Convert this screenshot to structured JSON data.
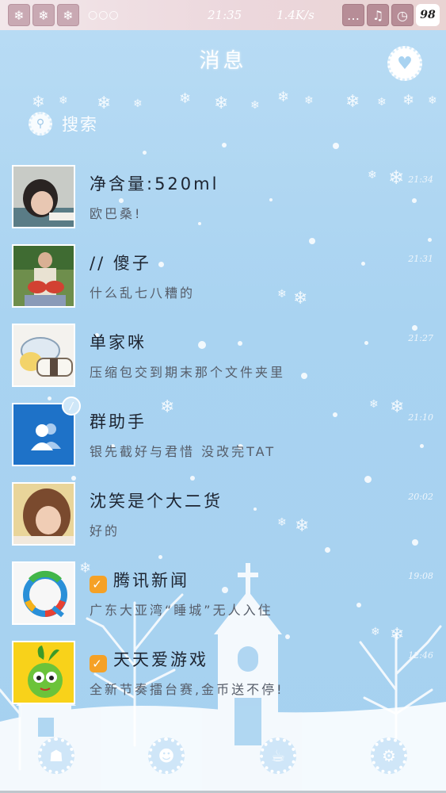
{
  "status_bar": {
    "left_icons": [
      "snowflake-icon",
      "snowflake-icon",
      "snowflake-icon"
    ],
    "more": "○○○",
    "time": "21:35",
    "speed": "1.4K/s",
    "right_icons": [
      "chat-icon",
      "music-icon",
      "clock-icon"
    ],
    "battery": "98"
  },
  "header": {
    "title": "消息",
    "right_icon": "heart-icon"
  },
  "search": {
    "placeholder": "搜索",
    "icon": "search-icon"
  },
  "conversations": [
    {
      "name": "净含量:520ml",
      "preview": "欧巴桑!",
      "time": "21:34"
    },
    {
      "name": "//        傻子",
      "preview": "什么乱七八糟的",
      "time": "21:31"
    },
    {
      "name": "单家咪",
      "preview": "压缩包交到期末那个文件夹里",
      "time": "21:27"
    },
    {
      "name": "群助手",
      "preview": "银先截好与君惜 没改完TAT",
      "time": "21:10"
    },
    {
      "name": "沈笑是个大二货",
      "preview": "好的",
      "time": "20:02"
    },
    {
      "name": "腾讯新闻",
      "preview": "广东大亚湾“睡城”无人入住",
      "time": "19:08",
      "verified": true
    },
    {
      "name": "天天爱游戏",
      "preview": "全新节奏擂台赛,金币送不停!",
      "time": "12:46",
      "verified": true
    }
  ],
  "bottom_nav": [
    {
      "icon": "ghost-icon"
    },
    {
      "icon": "contact-icon"
    },
    {
      "icon": "cup-icon"
    },
    {
      "icon": "gear-icon"
    }
  ],
  "colors": {
    "background": "#a9d3f1",
    "status_bar": "#ecd7dc",
    "badge": "#f5a126",
    "group_avatar": "#1e72c8"
  }
}
